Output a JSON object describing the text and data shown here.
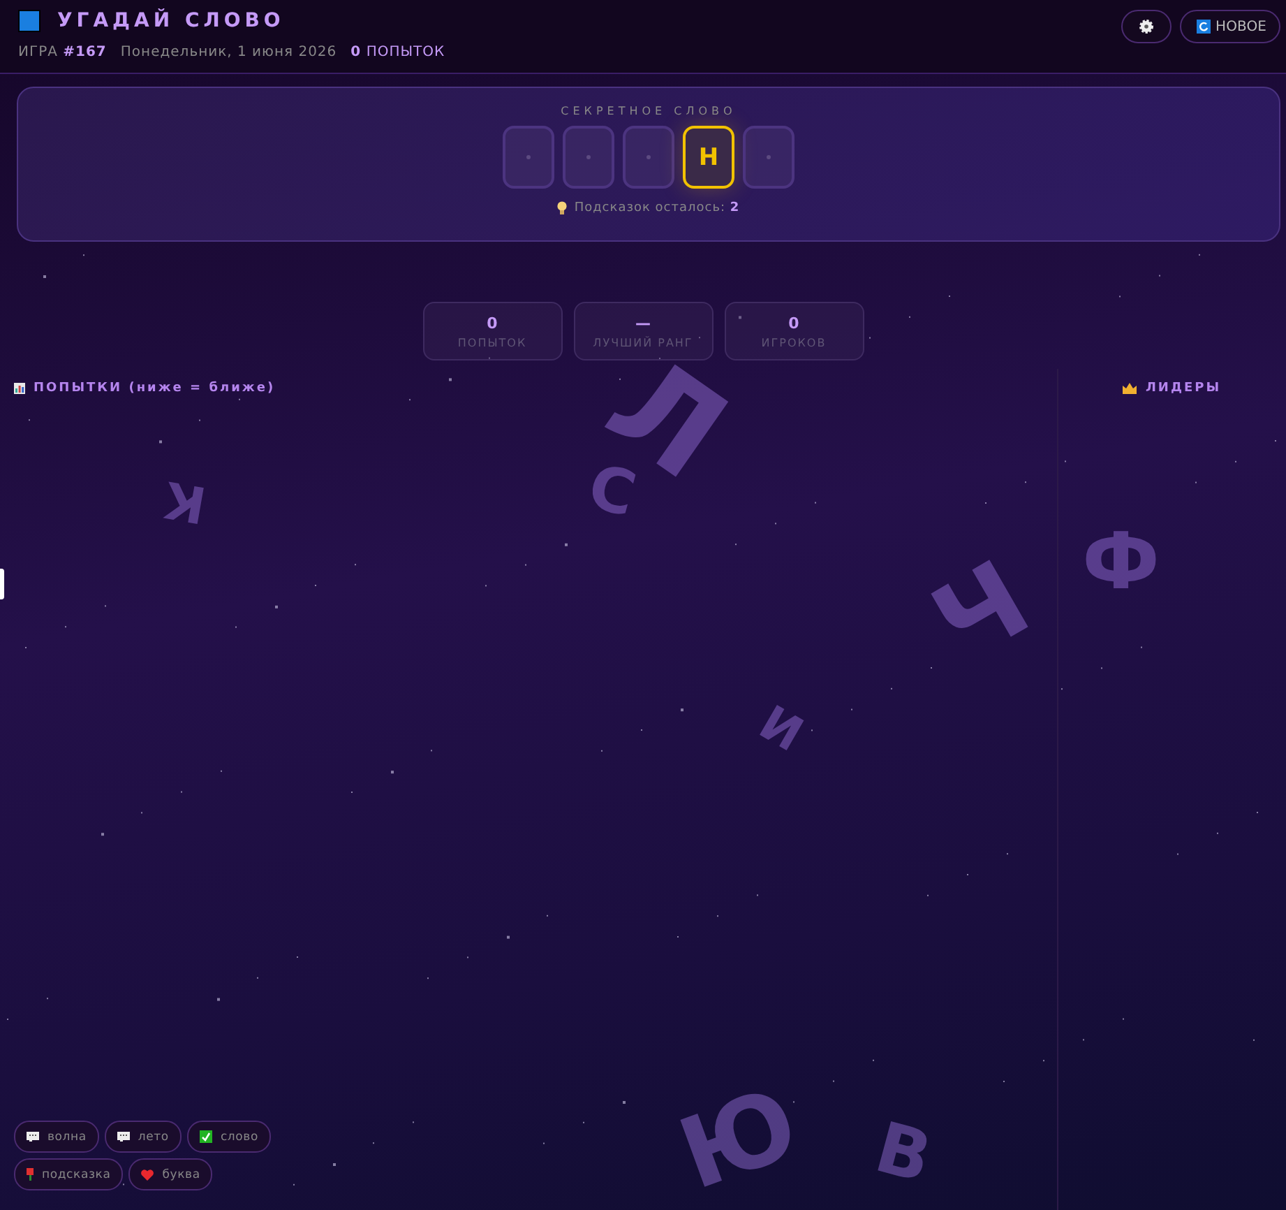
{
  "header": {
    "title": "УГАДАЙ СЛОВО",
    "game_label": "ИГРА",
    "game_number": "#167",
    "date": "Понедельник, 1 июня 2026",
    "attempts": "**0** ПОПЫТОК",
    "new_button": "НОВОЕ"
  },
  "secret": {
    "label": "СЕКРЕТНОЕ СЛОВО",
    "slots": [
      {
        "revealed": false
      },
      {
        "revealed": false
      },
      {
        "revealed": false
      },
      {
        "revealed": true,
        "letter": "Н"
      },
      {
        "revealed": false
      }
    ],
    "hints": "Подсказок осталось: **2**"
  },
  "stats": [
    {
      "value": "0",
      "label": "ПОПЫТОК"
    },
    {
      "value": "—",
      "label": "ЛУЧШИЙ РАНГ"
    },
    {
      "value": "0",
      "label": "ИГРОКОВ"
    }
  ],
  "attempts_panel": {
    "title": "ПОПЫТКИ (ниже = ближе)"
  },
  "leaders_panel": {
    "title": "ЛИДЕРЫ"
  },
  "chips": [
    {
      "kind": "comment",
      "label": "волна"
    },
    {
      "kind": "comment",
      "label": "лето"
    },
    {
      "kind": "check",
      "label": "слово"
    },
    {
      "kind": "flower",
      "label": "подсказка"
    },
    {
      "kind": "heart",
      "label": "буква"
    }
  ],
  "background_letters": [
    "Л",
    "С",
    "К",
    "Ч",
    "Ф",
    "И",
    "Ю",
    "В"
  ]
}
